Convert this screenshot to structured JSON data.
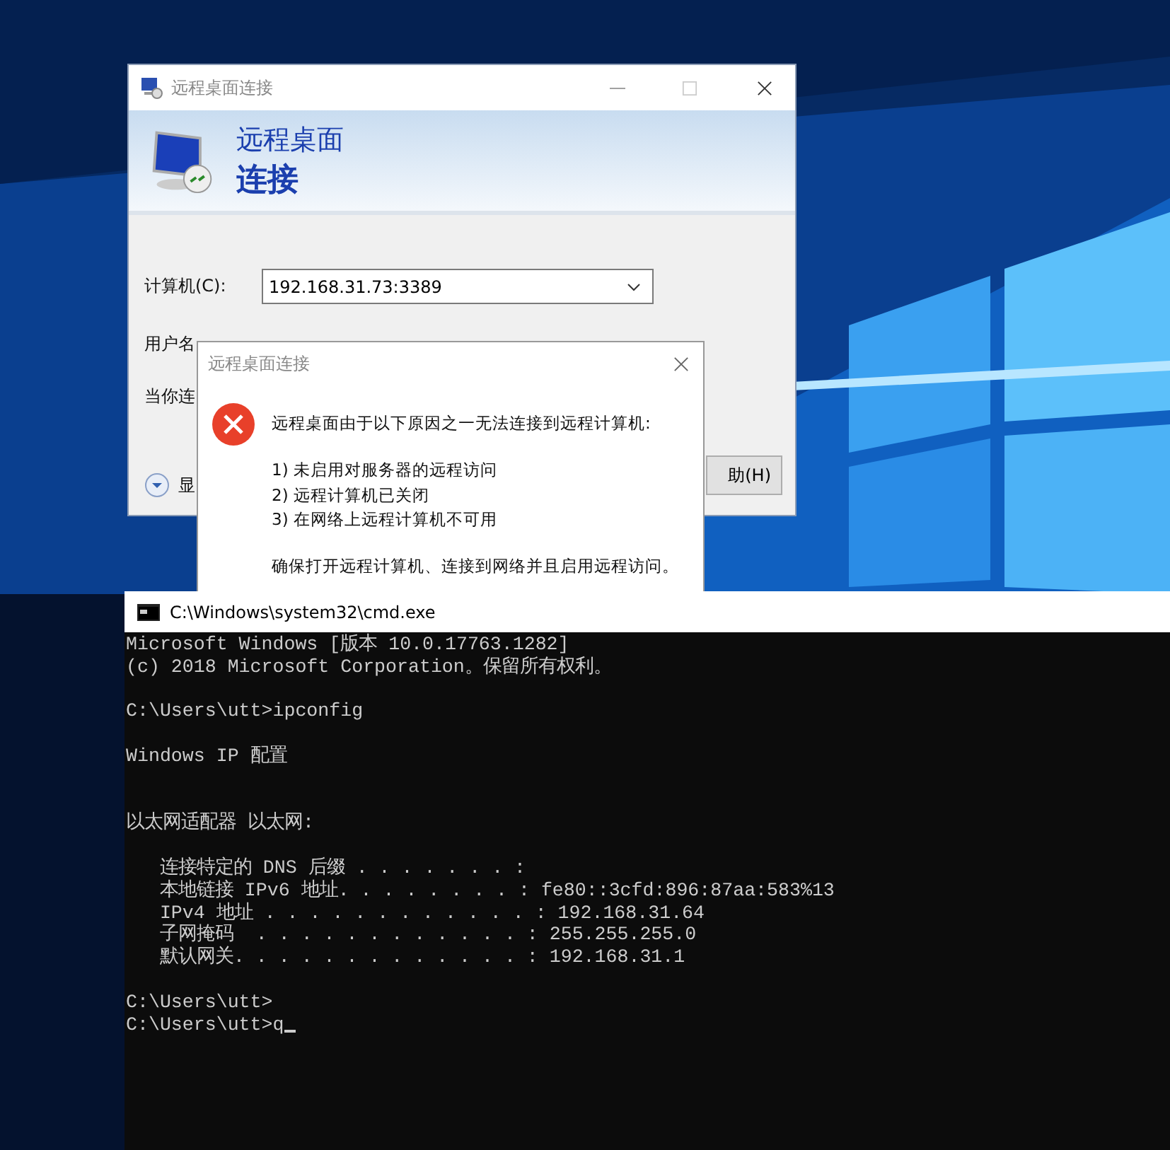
{
  "remote_desktop_window": {
    "title": "远程桌面连接",
    "banner_line_1": "远程桌面",
    "banner_line_2": "连接",
    "computer_label": "计算机(C):",
    "computer_value": "192.168.31.73:3389",
    "username_label": "用户名",
    "note_text": "当你连",
    "options_label": "显",
    "help_button": "助(H)"
  },
  "error_dialog": {
    "title": "远程桌面连接",
    "message": "远程桌面由于以下原因之一无法连接到远程计算机:",
    "reasons": [
      "1) 未启用对服务器的远程访问",
      "2) 远程计算机已关闭",
      "3) 在网络上远程计算机不可用"
    ],
    "advice": "确保打开远程计算机、连接到网络并且启用远程访问。"
  },
  "console": {
    "title": "C:\\Windows\\system32\\cmd.exe",
    "lines": [
      {
        "kind": "text",
        "text": "Microsoft Windows [版本 10.0.17763.1282]"
      },
      {
        "kind": "text",
        "text": "(c) 2018 Microsoft Corporation。保留所有权利。"
      },
      {
        "kind": "blank"
      },
      {
        "kind": "text",
        "text": "C:\\Users\\utt>ipconfig"
      },
      {
        "kind": "blank"
      },
      {
        "kind": "text",
        "text": "Windows IP 配置"
      },
      {
        "kind": "blank"
      },
      {
        "kind": "blank"
      },
      {
        "kind": "text",
        "text": "以太网适配器 以太网:"
      },
      {
        "kind": "blank"
      },
      {
        "kind": "text",
        "text": "   连接特定的 DNS 后缀 . . . . . . . :"
      },
      {
        "kind": "text",
        "text": "   本地链接 IPv6 地址. . . . . . . . : fe80::3cfd:896:87aa:583%13"
      },
      {
        "kind": "text",
        "text": "   IPv4 地址 . . . . . . . . . . . . : 192.168.31.64"
      },
      {
        "kind": "text",
        "text": "   子网掩码  . . . . . . . . . . . . : 255.255.255.0"
      },
      {
        "kind": "text",
        "text": "   默认网关. . . . . . . . . . . . . : 192.168.31.1"
      },
      {
        "kind": "blank"
      },
      {
        "kind": "text",
        "text": "C:\\Users\\utt>"
      }
    ],
    "input": "C:\\Users\\utt>q"
  }
}
